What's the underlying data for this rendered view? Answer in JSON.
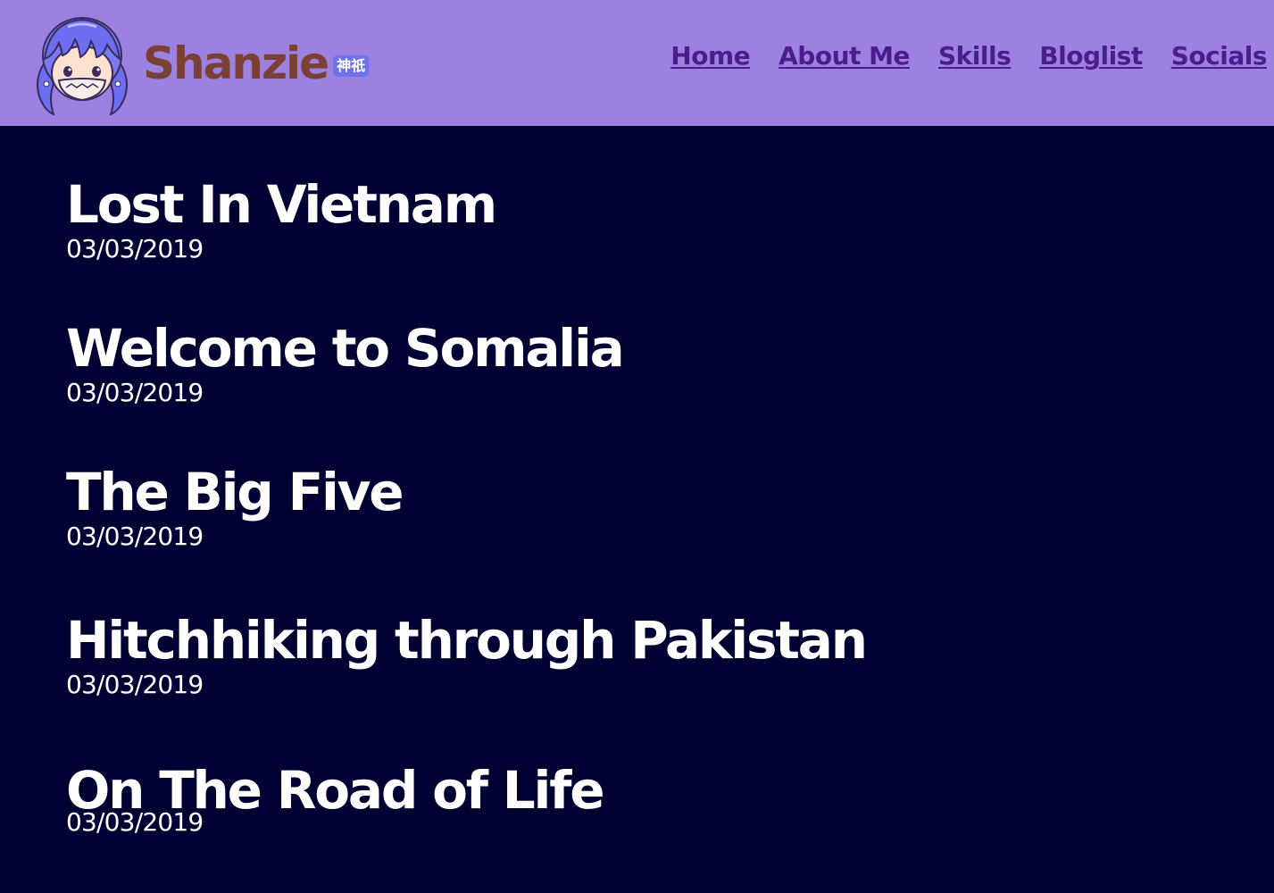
{
  "header": {
    "brand_name": "Shanzie",
    "brand_badge": "神祇",
    "avatar_icon": "girl-avatar-icon",
    "background_color": "#9d81e0",
    "brand_color": "#7a4035",
    "badge_color": "#6f72ee"
  },
  "nav": {
    "items": [
      {
        "label": "Home"
      },
      {
        "label": "About Me"
      },
      {
        "label": "Skills"
      },
      {
        "label": "Bloglist"
      },
      {
        "label": "Socials"
      }
    ],
    "link_color": "#4b1c8e"
  },
  "main": {
    "background_color": "#000033",
    "posts": [
      {
        "title": "Lost In Vietnam",
        "date": "03/03/2019"
      },
      {
        "title": "Welcome to Somalia",
        "date": "03/03/2019"
      },
      {
        "title": "The Big Five",
        "date": "03/03/2019"
      },
      {
        "title": "Hitchhiking through Pakistan",
        "date": "03/03/2019"
      },
      {
        "title": "On The Road of Life",
        "date": "03/03/2019"
      }
    ]
  }
}
